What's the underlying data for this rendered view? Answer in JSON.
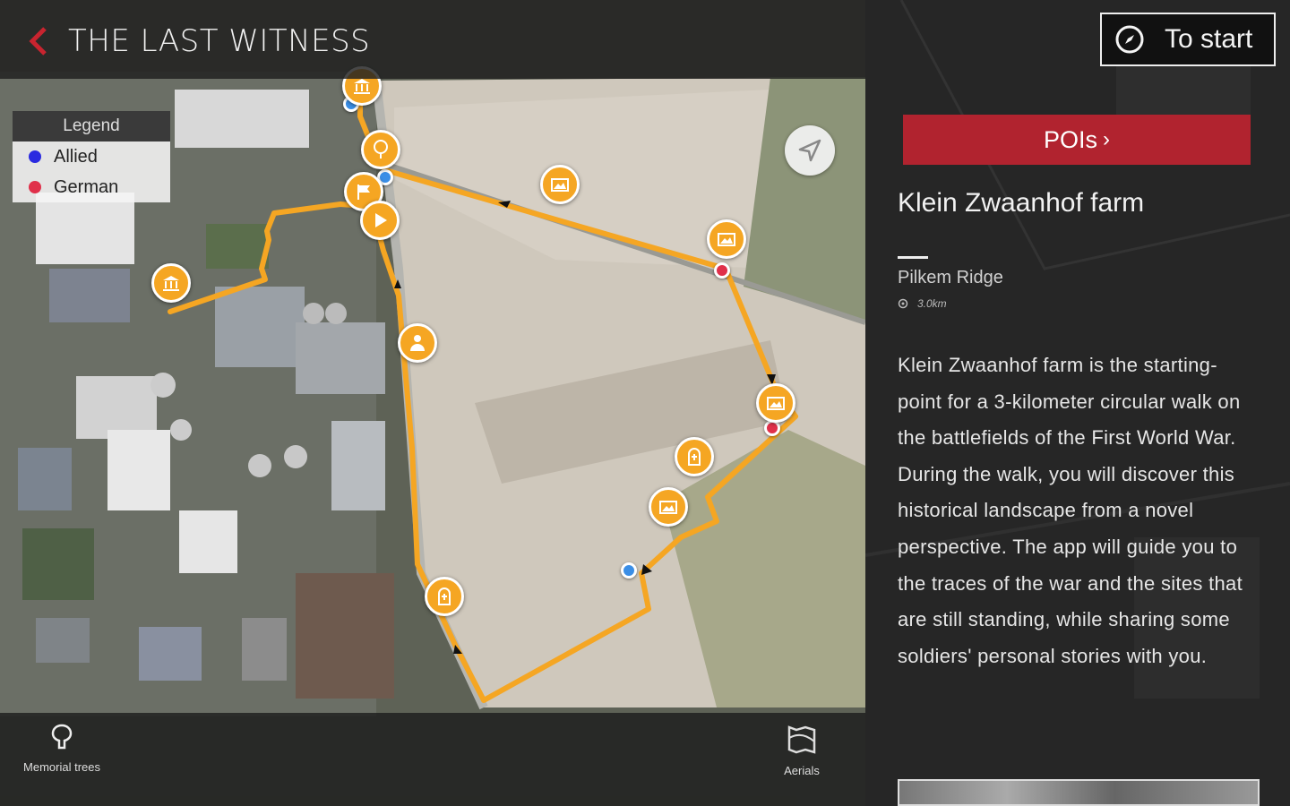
{
  "header": {
    "title": "THE LAST WITNESS",
    "back_icon": "chevron-left-icon"
  },
  "legend": {
    "title": "Legend",
    "items": [
      {
        "label": "Allied",
        "color": "#2a2ae0"
      },
      {
        "label": "German",
        "color": "#e0304a"
      }
    ]
  },
  "map": {
    "route_color": "#f5a623",
    "poi_icons": [
      "museum-icon",
      "tree-icon",
      "camera-icon",
      "flag-icon",
      "play-icon",
      "person-icon",
      "camera-icon",
      "camera-icon",
      "tombstone-icon",
      "camera-icon",
      "tombstone-icon",
      "museum-icon"
    ],
    "compass_icon": "navigate-arrow-icon"
  },
  "bottom_bar": {
    "memorial_trees_label": "Memorial trees",
    "aerials_label": "Aerials"
  },
  "panel": {
    "to_start_label": "To start",
    "pois_label": "POIs",
    "poi_title": "Klein Zwaanhof farm",
    "poi_subtitle": "Pilkem Ridge",
    "poi_distance": "3.0km",
    "poi_description": "Klein Zwaanhof farm is the starting-point for a 3-kilometer circular walk on the battlefields of the First World War. During the walk, you will discover this historical landscape from a novel perspective. The app will guide you to the traces of the war and the sites that are still standing, while sharing some soldiers' personal stories with you.",
    "accent_color": "#b1232f"
  }
}
